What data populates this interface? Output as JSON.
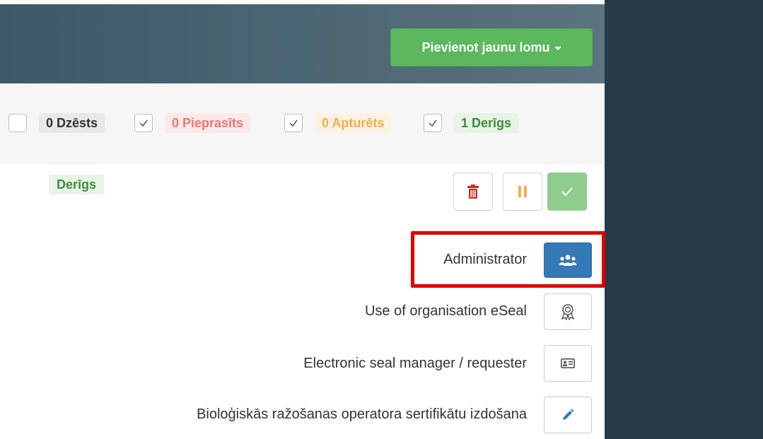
{
  "header": {
    "add_role_label": "Pievienot jaunu lomu"
  },
  "filters": [
    {
      "label": "0 Dzēsts",
      "checked": false
    },
    {
      "label": "0 Pieprasīts",
      "checked": true
    },
    {
      "label": "0 Apturēts",
      "checked": true
    },
    {
      "label": "1 Derīgs",
      "checked": true
    }
  ],
  "status": {
    "badge": "Derīgs"
  },
  "roles": [
    {
      "label": "Administrator",
      "icon": "users-icon",
      "active": true
    },
    {
      "label": "Use of organisation eSeal",
      "icon": "award-icon",
      "active": false
    },
    {
      "label": "Electronic seal manager / requester",
      "icon": "id-card-icon",
      "active": false
    },
    {
      "label": "Bioloģiskās ražošanas operatora sertifikātu izdošana",
      "icon": "pencil-icon",
      "active": false
    }
  ],
  "colors": {
    "header_bg": "#4a6270",
    "add_button": "#5cb85c",
    "right_panel": "#263a47",
    "highlight": "#e00000",
    "active_role": "#337ab7"
  }
}
